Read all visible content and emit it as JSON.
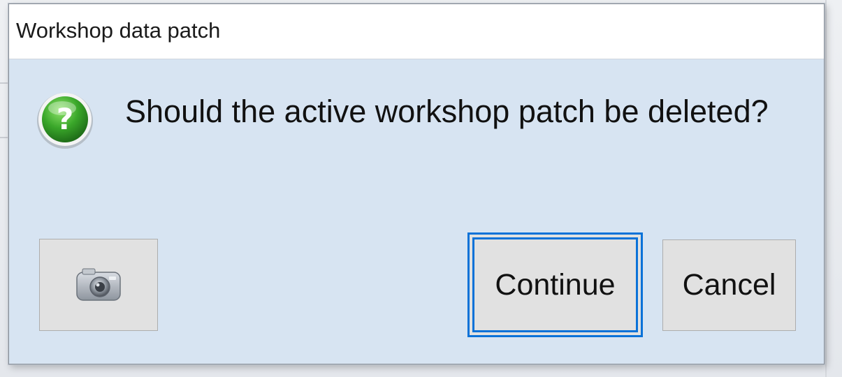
{
  "dialog": {
    "title": "Workshop data patch",
    "message": "Should the active workshop patch be deleted?",
    "icon": "question-icon"
  },
  "buttons": {
    "screenshot_icon": "camera-icon",
    "continue_label": "Continue",
    "cancel_label": "Cancel"
  },
  "colors": {
    "dialog_background": "#d7e4f2",
    "titlebar_background": "#ffffff",
    "button_background": "#e1e1e1",
    "focus_border": "#0a72d8",
    "question_icon_green": "#3aa72a"
  }
}
